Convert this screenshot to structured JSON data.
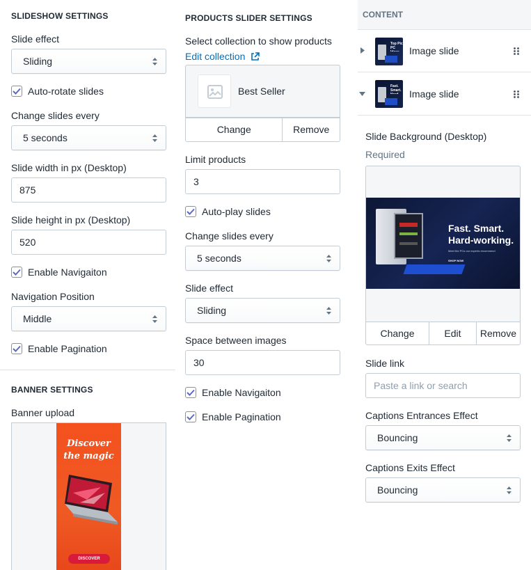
{
  "slideshow": {
    "title": "SLIDESHOW SETTINGS",
    "slide_effect_label": "Slide effect",
    "slide_effect_value": "Sliding",
    "auto_rotate_label": "Auto-rotate slides",
    "change_every_label": "Change slides every",
    "change_every_value": "5 seconds",
    "width_label": "Slide width in px (Desktop)",
    "width_value": "875",
    "height_label": "Slide height in px (Desktop)",
    "height_value": "520",
    "enable_nav_label": "Enable Navigaiton",
    "nav_position_label": "Navigation Position",
    "nav_position_value": "Middle",
    "enable_pagination_label": "Enable Pagination"
  },
  "banner": {
    "title": "BANNER SETTINGS",
    "upload_label": "Banner upload",
    "image_heading_line1": "Discover",
    "image_heading_line2": "the magic",
    "image_button": "DISCOVER"
  },
  "products_slider": {
    "title": "PRODUCTS SLIDER SETTINGS",
    "select_collection_label": "Select collection to show products",
    "edit_collection_link": "Edit collection",
    "collection_name": "Best Seller",
    "change_button": "Change",
    "remove_button": "Remove",
    "limit_label": "Limit products",
    "limit_value": "3",
    "autoplay_label": "Auto-play slides",
    "change_every_label": "Change slides every",
    "change_every_value": "5 seconds",
    "slide_effect_label": "Slide effect",
    "slide_effect_value": "Sliding",
    "space_label": "Space between images",
    "space_value": "30",
    "enable_nav_label": "Enable Navigaiton",
    "enable_pagination_label": "Enable Pagination"
  },
  "content": {
    "title": "CONTENT",
    "items": [
      {
        "label": "Image slide",
        "thumb_text": "Top Pic PC Ideas"
      },
      {
        "label": "Image slide",
        "thumb_text": "Fast. Smart. Hard-work"
      }
    ],
    "bg_label": "Slide Background (Desktop)",
    "required_label": "Required",
    "preview": {
      "headline1": "Fast. Smart.",
      "headline2": "Hard-working.",
      "subline": "Meet the PCs our experts recommend",
      "cta": "SHOP NOW"
    },
    "change_button": "Change",
    "edit_button": "Edit",
    "remove_button": "Remove",
    "slide_link_label": "Slide link",
    "slide_link_placeholder": "Paste a link or search",
    "captions_enter_label": "Captions Entrances Effect",
    "captions_enter_value": "Bouncing",
    "captions_exit_label": "Captions Exits Effect",
    "captions_exit_value": "Bouncing"
  },
  "colors": {
    "checkbox": "#5c6ac4",
    "link": "#006fbb",
    "banner_orange": "#f4511e"
  }
}
